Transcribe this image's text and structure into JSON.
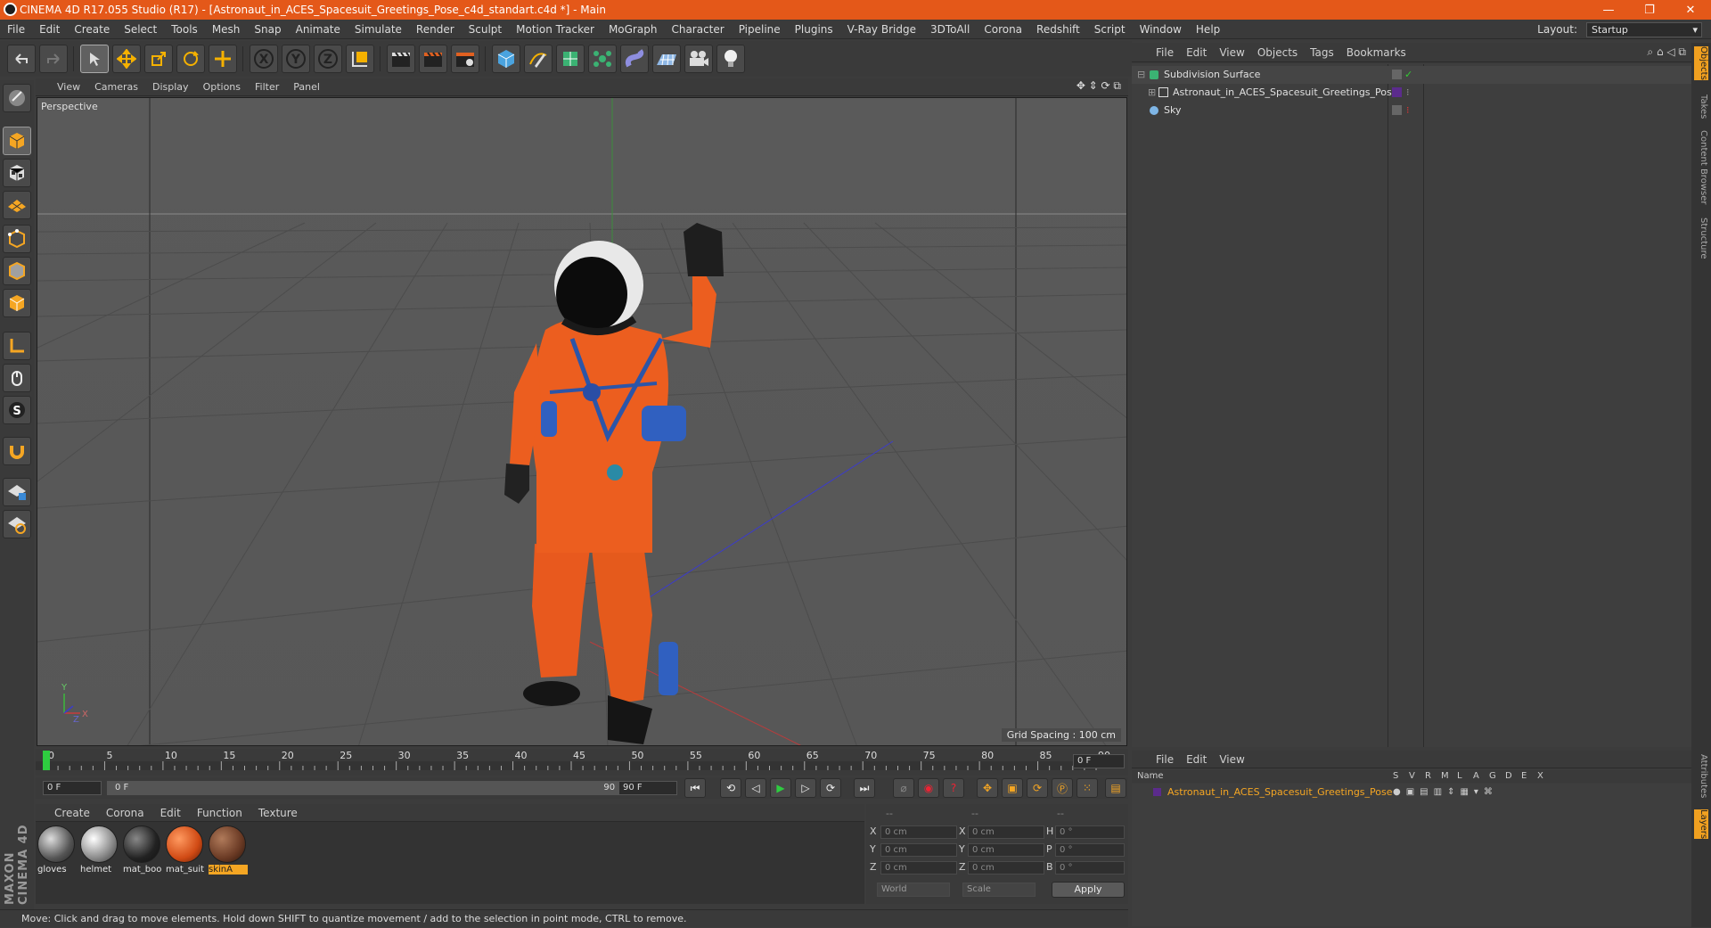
{
  "window": {
    "title": "CINEMA 4D R17.055 Studio (R17) - [Astronaut_in_ACES_Spacesuit_Greetings_Pose_c4d_standart.c4d *] - Main",
    "controls": [
      "—",
      "❐",
      "✕"
    ]
  },
  "menubar": {
    "items": [
      "File",
      "Edit",
      "Create",
      "Select",
      "Tools",
      "Mesh",
      "Snap",
      "Animate",
      "Simulate",
      "Render",
      "Sculpt",
      "Motion Tracker",
      "MoGraph",
      "Character",
      "Pipeline",
      "Plugins",
      "V-Ray Bridge",
      "3DToAll",
      "Corona",
      "Redshift",
      "Script",
      "Window",
      "Help"
    ],
    "layout_label": "Layout:",
    "layout_value": "Startup"
  },
  "viewport": {
    "menu": [
      "View",
      "Cameras",
      "Display",
      "Options",
      "Filter",
      "Panel"
    ],
    "label": "Perspective",
    "grid_spacing": "Grid Spacing : 100 cm",
    "axis_labels": [
      "Y",
      "X",
      "Z"
    ]
  },
  "timeline": {
    "ticks": [
      "0",
      "5",
      "10",
      "15",
      "20",
      "25",
      "30",
      "35",
      "40",
      "45",
      "50",
      "55",
      "60",
      "65",
      "70",
      "75",
      "80",
      "85",
      "90"
    ],
    "current_frame": "0 F",
    "start_field": "0 F",
    "range_start": "0 F",
    "range_end": "90 F",
    "end_field": "90 F"
  },
  "materials": {
    "menu": [
      "Create",
      "Corona",
      "Edit",
      "Function",
      "Texture"
    ],
    "items": [
      {
        "name": "gloves",
        "selected": false,
        "color": "#9a9a9a"
      },
      {
        "name": "helmet",
        "selected": false,
        "color": "#bdbdbd"
      },
      {
        "name": "mat_boo",
        "selected": false,
        "color": "#3a3a3a"
      },
      {
        "name": "mat_suit",
        "selected": false,
        "color": "#e06020"
      },
      {
        "name": "skinA",
        "selected": true,
        "color": "#7a4a35"
      }
    ]
  },
  "coords": {
    "headers": [
      "--",
      "--",
      "--"
    ],
    "rows": [
      {
        "a": "X",
        "av": "0 cm",
        "b": "X",
        "bv": "0 cm",
        "c": "H",
        "cv": "0 °"
      },
      {
        "a": "Y",
        "av": "0 cm",
        "b": "Y",
        "bv": "0 cm",
        "c": "P",
        "cv": "0 °"
      },
      {
        "a": "Z",
        "av": "0 cm",
        "b": "Z",
        "bv": "0 cm",
        "c": "B",
        "cv": "0 °"
      }
    ],
    "mode_world": "World",
    "mode_scale": "Scale",
    "apply": "Apply"
  },
  "status": {
    "text": "Move: Click and drag to move elements. Hold down SHIFT to quantize movement / add to the selection in point mode, CTRL to remove."
  },
  "objects": {
    "menu": [
      "File",
      "Edit",
      "View",
      "Objects",
      "Tags",
      "Bookmarks"
    ],
    "items": [
      {
        "name": "Subdivision Surface",
        "indent": 0
      },
      {
        "name": "Astronaut_in_ACES_Spacesuit_Greetings_Pose",
        "indent": 1
      },
      {
        "name": "Sky",
        "indent": 0
      }
    ]
  },
  "layers": {
    "menu": [
      "File",
      "Edit",
      "View"
    ],
    "header_name": "Name",
    "header_flags": [
      "S",
      "V",
      "R",
      "M",
      "L",
      "A",
      "G",
      "D",
      "E",
      "X"
    ],
    "items": [
      {
        "name": "Astronaut_in_ACES_Spacesuit_Greetings_Pose",
        "color": "#f5a623"
      }
    ]
  },
  "right_tabs": [
    "Objects",
    "Takes",
    "Content Browser",
    "Structure",
    "Attributes",
    "Layers"
  ],
  "brand": "MAXON CINEMA 4D",
  "colors": {
    "title_bar": "#e45819",
    "accent_selection": "#f5a623",
    "background": "#3c3c3c"
  }
}
